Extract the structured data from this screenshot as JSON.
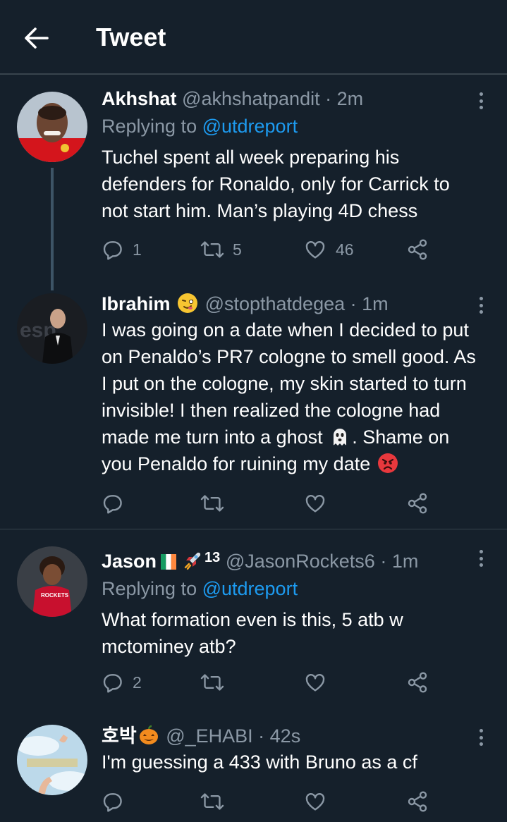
{
  "header": {
    "title": "Tweet"
  },
  "colors": {
    "background": "#15202b",
    "accent": "#1d9bf0",
    "muted": "#8b98a5",
    "divider": "#38444d"
  },
  "icons": [
    "back-arrow-icon",
    "reply-icon",
    "retweet-icon",
    "like-icon",
    "share-icon",
    "more-icon",
    "emoji-squint-icon",
    "ghost-icon",
    "angry-face-icon",
    "flag-ireland-icon",
    "rocket-icon",
    "jack-o-lantern-icon"
  ],
  "tweets": [
    {
      "name": "Akhshat",
      "handle": "@akhshatpandit",
      "time": "· 2m",
      "replying_prefix": "Replying to ",
      "replying_to": "@utdreport",
      "text": [
        "Tuchel spent all week preparing his",
        "defenders for Ronaldo, only for Carrick to",
        "not start him. Man’s playing 4D chess"
      ],
      "replies": "1",
      "retweets": "5",
      "likes": "46"
    },
    {
      "name": "Ibrahim",
      "handle": "@stopthatdegea",
      "time": "· 1m",
      "text": [
        "I was going on a date when I decided to put",
        "on Penaldo’s PR7 cologne to smell good. As",
        "I put on the cologne, my skin started to turn",
        "invisible! I then realized the cologne had",
        "made me turn into a ghost",
        ". Shame on",
        "you Penaldo for ruining my date"
      ],
      "avatar_text": "esp"
    },
    {
      "name": "Jason",
      "name_suffix": "13",
      "handle": "@JasonRockets6",
      "time": "· 1m",
      "replying_prefix": "Replying to ",
      "replying_to": "@utdreport",
      "text": [
        "What formation even is this, 5 atb w",
        "mctominey atb?"
      ],
      "replies": "2",
      "avatar_text": "ROCKETS"
    },
    {
      "name": "호박",
      "handle": "@_EHABI",
      "time": "· 42s",
      "text": [
        "I'm guessing a 433 with Bruno as a cf"
      ]
    }
  ]
}
